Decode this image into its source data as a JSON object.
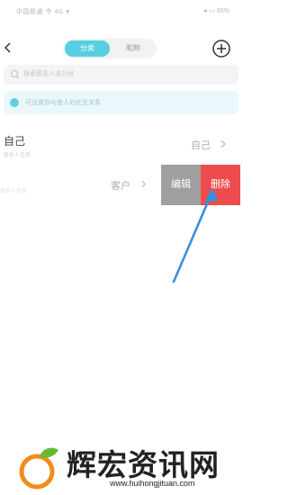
{
  "status": {
    "left": "中国联通  令 4G ♥",
    "right": "● ▭ 66%"
  },
  "nav": {
    "tab_active": "分类",
    "tab_inactive": "昵称"
  },
  "search": {
    "placeholder": "搜索联系人或分组"
  },
  "tip": {
    "text": "可设置你与他人的社交关系"
  },
  "rows": [
    {
      "title": "自己",
      "subtitle": "联系人信息",
      "value": "自己"
    },
    {
      "faint": "联系人信息",
      "value": "客户",
      "edit": "编辑",
      "delete": "删除"
    }
  ],
  "watermark": {
    "title": "辉宏资讯网",
    "url": "www.huihongjituan.com"
  },
  "colors": {
    "accent": "#56cfe1",
    "delete": "#ee4c4c",
    "edit": "#9f9f9f",
    "arrow": "#3a8fe0"
  }
}
